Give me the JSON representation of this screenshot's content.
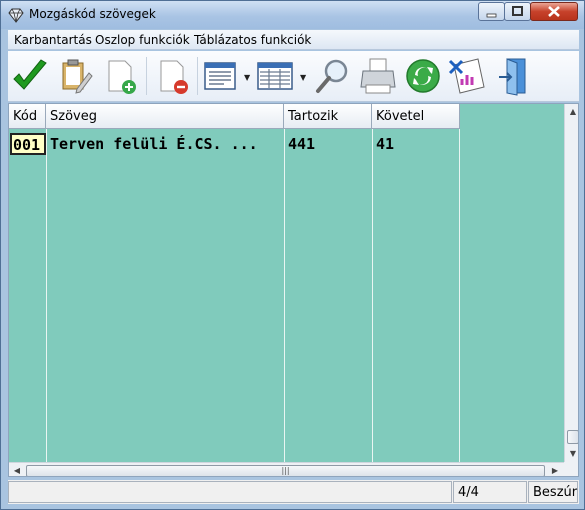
{
  "window": {
    "title": "Mozgáskód szövegek",
    "icon": "diamond-icon"
  },
  "menu": {
    "items": [
      "Karbantartás",
      "Oszlop funkciók",
      "Táblázatos funkciók"
    ]
  },
  "toolbar": {
    "buttons": [
      {
        "icon": "checkmark-icon"
      },
      {
        "icon": "clipboard-edit-icon"
      },
      {
        "icon": "new-record-icon"
      },
      {
        "icon": "delete-record-icon"
      },
      {
        "icon": "form-view-icon"
      },
      {
        "icon": "table-view-icon"
      },
      {
        "icon": "search-icon"
      },
      {
        "icon": "printer-icon"
      },
      {
        "icon": "refresh-icon"
      },
      {
        "icon": "excel-export-icon"
      },
      {
        "icon": "exit-door-icon"
      }
    ]
  },
  "grid": {
    "columns": [
      "Kód",
      "Szöveg",
      "Tartozik",
      "Követel"
    ],
    "rows": [
      {
        "kod": "001",
        "szoveg": "Terven felüli É.CS. ...",
        "tartozik": "441",
        "kovetel": "41"
      }
    ],
    "colors": {
      "background": "#80cbbc",
      "selected": "#ffffc7"
    }
  },
  "status": {
    "record": "4/4",
    "mode": "Beszúr"
  }
}
